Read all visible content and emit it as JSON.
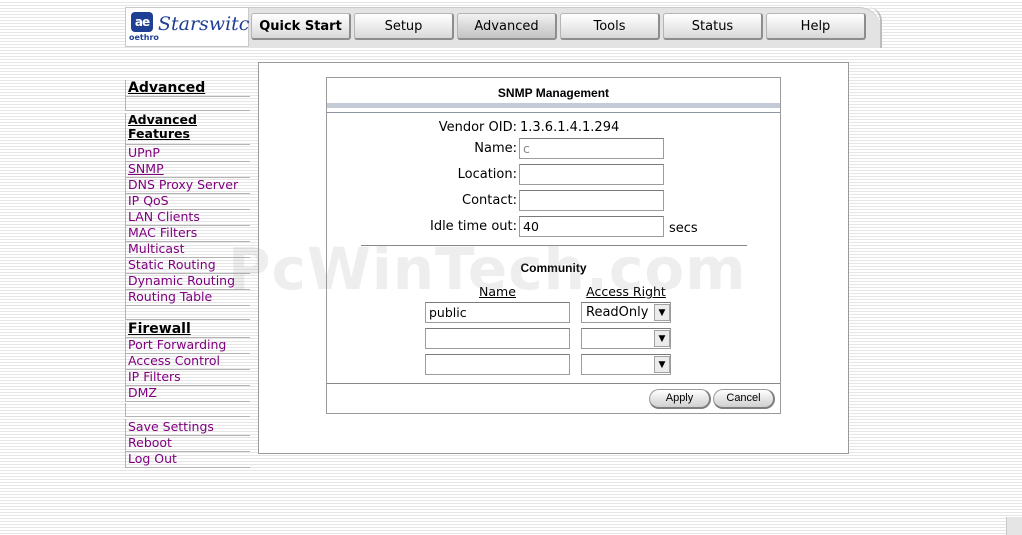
{
  "logo": {
    "mark": "ae",
    "sub": "oethro",
    "name": "Starswitch"
  },
  "tabs": [
    {
      "label": "Quick Start",
      "active": false
    },
    {
      "label": "Setup",
      "active": false
    },
    {
      "label": "Advanced",
      "active": true
    },
    {
      "label": "Tools",
      "active": false
    },
    {
      "label": "Status",
      "active": false
    },
    {
      "label": "Help",
      "active": false
    }
  ],
  "nav": {
    "heading": "Advanced",
    "features_heading": "Advanced Features",
    "features": [
      "UPnP",
      "SNMP",
      "DNS Proxy Server",
      "IP QoS",
      "LAN Clients",
      "MAC Filters",
      "Multicast",
      "Static Routing",
      "Dynamic Routing",
      "Routing Table"
    ],
    "firewall_heading": "Firewall",
    "firewall": [
      "Port Forwarding",
      "Access Control",
      "IP Filters",
      "DMZ"
    ],
    "actions": [
      "Save Settings",
      "Reboot",
      "Log Out"
    ]
  },
  "snmp": {
    "title": "SNMP Management",
    "vendor_oid_label": "Vendor OID:",
    "vendor_oid_value": "1.3.6.1.4.1.294",
    "name_label": "Name:",
    "name_value": "c",
    "location_label": "Location:",
    "location_value": "",
    "contact_label": "Contact:",
    "contact_value": "",
    "idle_label": "Idle time out:",
    "idle_value": "40",
    "idle_unit": "secs",
    "community_title": "Community",
    "col_name": "Name",
    "col_access": "Access Right",
    "community": [
      {
        "name": "public",
        "access": "ReadOnly"
      },
      {
        "name": "",
        "access": ""
      },
      {
        "name": "",
        "access": ""
      }
    ],
    "apply_label": "Apply",
    "cancel_label": "Cancel"
  },
  "watermark": "PcWinTech.com"
}
